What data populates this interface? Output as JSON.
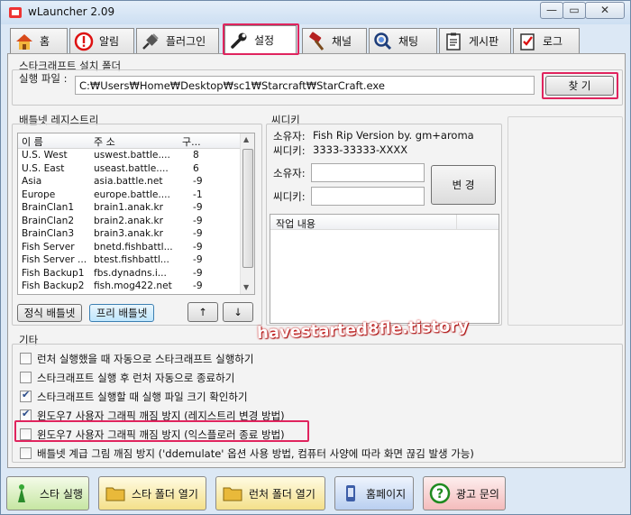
{
  "window": {
    "title": "wLauncher 2.09"
  },
  "tabs": [
    {
      "label": "홈",
      "icon": "home-icon"
    },
    {
      "label": "알림",
      "icon": "alert-icon"
    },
    {
      "label": "플러그인",
      "icon": "plugin-icon"
    },
    {
      "label": "설정",
      "icon": "wrench-icon",
      "active": true
    },
    {
      "label": "채널",
      "icon": "hammer-icon"
    },
    {
      "label": "채팅",
      "icon": "chat-icon"
    },
    {
      "label": "게시판",
      "icon": "clipboard-icon"
    },
    {
      "label": "로그",
      "icon": "checklist-icon"
    }
  ],
  "starcraft_folder": {
    "title": "스타크래프트 설치 폴더",
    "exe_label": "실행 파일 :",
    "exe_path": "C:₩Users₩Home₩Desktop₩sc1₩Starcraft₩StarCraft.exe",
    "find_button": "찾 기"
  },
  "registry": {
    "title": "배틀넷 레지스트리",
    "columns": [
      "이 름",
      "주 소",
      "구..."
    ],
    "rows": [
      [
        "U.S. West",
        "uswest.battle....",
        "8"
      ],
      [
        "U.S. East",
        "useast.battle....",
        "6"
      ],
      [
        "Asia",
        "asia.battle.net",
        "-9"
      ],
      [
        "Europe",
        "europe.battle....",
        "-1"
      ],
      [
        "BrainClan1",
        "brain1.anak.kr",
        "-9"
      ],
      [
        "BrainClan2",
        "brain2.anak.kr",
        "-9"
      ],
      [
        "BrainClan3",
        "brain3.anak.kr",
        "-9"
      ],
      [
        "Fish Server",
        "bnetd.fishbattl...",
        "-9"
      ],
      [
        "Fish Server ...",
        "btest.fishbattl...",
        "-9"
      ],
      [
        "Fish Backup1",
        "fbs.dynadns.i...",
        "-9"
      ],
      [
        "Fish Backup2",
        "fish.mog422.net",
        "-9"
      ]
    ],
    "official_button": "정식 배틀넷",
    "free_button": "프리 배틀넷",
    "up_button": "↑",
    "down_button": "↓"
  },
  "cdkey": {
    "title": "씨디키",
    "owner_label": "소유자:",
    "owner_value": "Fish Rip Version by. gm+aroma",
    "key_label": "씨디키:",
    "key_value": "3333-33333-XXXX",
    "owner_input_label": "소유자:",
    "key_input_label": "씨디키:",
    "change_button": "변 경",
    "log_header": "작업 내용"
  },
  "misc": {
    "title": "기타",
    "options": [
      {
        "label": "런처 실행했을 때 자동으로 스타크래프트 실행하기",
        "checked": false
      },
      {
        "label": "스타크래프트 실행 후 런처 자동으로 종료하기",
        "checked": false
      },
      {
        "label": "스타크래프트 실행할 때 실행 파일 크기 확인하기",
        "checked": true
      },
      {
        "label": "윈도우7 사용자 그래픽 깨짐 방지 (레지스트리 변경 방법)",
        "checked": true
      },
      {
        "label": "윈도우7 사용자 그래픽 깨짐 방지 (익스플로러 종료 방법)",
        "checked": false
      },
      {
        "label": "배틀넷 계급 그림 깨짐 방지 ('ddemulate' 옵션 사용 방법, 컴퓨터 사양에 따라 화면 끊김 발생 가능)",
        "checked": false
      }
    ]
  },
  "watermark": "havestarted8fle.tistory",
  "bottom_buttons": [
    {
      "label": "스타 실행",
      "icon": "star-launch-icon"
    },
    {
      "label": "스타 폴더 열기",
      "icon": "folder-icon"
    },
    {
      "label": "런처 폴더 열기",
      "icon": "folder-icon"
    },
    {
      "label": "홈페이지",
      "icon": "homepage-icon"
    },
    {
      "label": "광고 문의",
      "icon": "question-icon"
    }
  ]
}
